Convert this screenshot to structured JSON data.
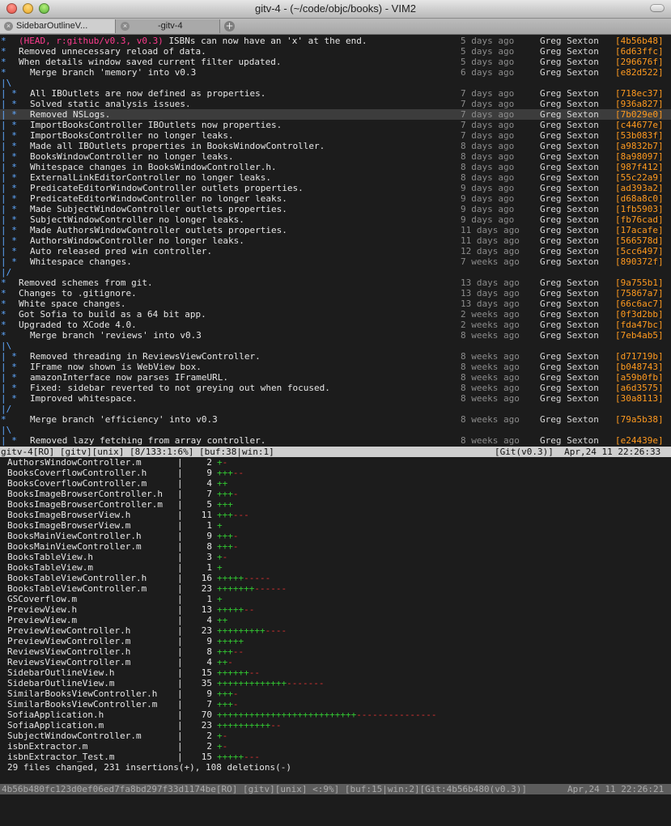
{
  "window": {
    "title": "gitv-4 - (~/code/objc/books) - VIM2"
  },
  "tabs": [
    {
      "label": "SidebarOutlineV...",
      "close": "×"
    },
    {
      "label": "-gitv-4",
      "close": "×"
    }
  ],
  "new_tab": "+",
  "log_lines": [
    {
      "graph": "*",
      "refs": "(HEAD, r:github/v0.3, v0.3)",
      "msg": "ISBNs can now have an 'x' at the end.",
      "date": "5 days ago",
      "author": "Greg Sexton",
      "sha": "[4b56b48]"
    },
    {
      "graph": "*",
      "msg": "Removed unnecessary reload of data.",
      "date": "5 days ago",
      "author": "Greg Sexton",
      "sha": "[6d63ffc]"
    },
    {
      "graph": "*",
      "msg": "When details window saved current filter updated.",
      "date": "5 days ago",
      "author": "Greg Sexton",
      "sha": "[296676f]"
    },
    {
      "graph": "*",
      "msg": "Merge branch 'memory' into v0.3",
      "date": "6 days ago",
      "author": "Greg Sexton",
      "sha": "[e82d522]",
      "merge": true
    },
    {
      "graph": "|\\"
    },
    {
      "graph": "| *",
      "msg": "All IBOutlets are now defined as properties.",
      "date": "7 days ago",
      "author": "Greg Sexton",
      "sha": "[718ec37]",
      "ind": true
    },
    {
      "graph": "| *",
      "msg": "Solved static analysis issues.",
      "date": "7 days ago",
      "author": "Greg Sexton",
      "sha": "[936a827]",
      "ind": true
    },
    {
      "graph": "| *",
      "msg": "Removed NSLogs.",
      "date": "7 days ago",
      "author": "Greg Sexton",
      "sha": "[7b029e0]",
      "ind": true,
      "cursor": true
    },
    {
      "graph": "| *",
      "msg": "ImportBooksController IBOutlets now properties.",
      "date": "7 days ago",
      "author": "Greg Sexton",
      "sha": "[c44677e]",
      "ind": true
    },
    {
      "graph": "| *",
      "msg": "ImportBooksController no longer leaks.",
      "date": "7 days ago",
      "author": "Greg Sexton",
      "sha": "[53b083f]",
      "ind": true
    },
    {
      "graph": "| *",
      "msg": "Made all IBOutlets properties in BooksWindowController.",
      "date": "8 days ago",
      "author": "Greg Sexton",
      "sha": "[a9832b7]",
      "ind": true
    },
    {
      "graph": "| *",
      "msg": "BooksWindowController no longer leaks.",
      "date": "8 days ago",
      "author": "Greg Sexton",
      "sha": "[8a98097]",
      "ind": true
    },
    {
      "graph": "| *",
      "msg": "Whitespace changes in BooksWindowController.h.",
      "date": "8 days ago",
      "author": "Greg Sexton",
      "sha": "[987f412]",
      "ind": true
    },
    {
      "graph": "| *",
      "msg": "ExternalLinkEditorController no longer leaks.",
      "date": "8 days ago",
      "author": "Greg Sexton",
      "sha": "[55c22a9]",
      "ind": true
    },
    {
      "graph": "| *",
      "msg": "PredicateEditorWindowController outlets properties.",
      "date": "9 days ago",
      "author": "Greg Sexton",
      "sha": "[ad393a2]",
      "ind": true
    },
    {
      "graph": "| *",
      "msg": "PredicateEditorWindowController no longer leaks.",
      "date": "9 days ago",
      "author": "Greg Sexton",
      "sha": "[d68a8c0]",
      "ind": true
    },
    {
      "graph": "| *",
      "msg": "Made SubjectWindowController outlets properties.",
      "date": "9 days ago",
      "author": "Greg Sexton",
      "sha": "[1fb5903]",
      "ind": true
    },
    {
      "graph": "| *",
      "msg": "SubjectWindowController no longer leaks.",
      "date": "9 days ago",
      "author": "Greg Sexton",
      "sha": "[fb76cad]",
      "ind": true
    },
    {
      "graph": "| *",
      "msg": "Made AuthorsWindowController outlets properties.",
      "date": "11 days ago",
      "author": "Greg Sexton",
      "sha": "[17acafe]",
      "ind": true
    },
    {
      "graph": "| *",
      "msg": "AuthorsWindowController no longer leaks.",
      "date": "11 days ago",
      "author": "Greg Sexton",
      "sha": "[566578d]",
      "ind": true
    },
    {
      "graph": "| *",
      "msg": "Auto released pred win controller.",
      "date": "12 days ago",
      "author": "Greg Sexton",
      "sha": "[5cc6497]",
      "ind": true
    },
    {
      "graph": "| *",
      "msg": "Whitespace changes.",
      "date": "7 weeks ago",
      "author": "Greg Sexton",
      "sha": "[890372f]",
      "ind": true
    },
    {
      "graph": "|/"
    },
    {
      "graph": "*",
      "msg": "Removed schemes from git.",
      "date": "13 days ago",
      "author": "Greg Sexton",
      "sha": "[9a755b1]"
    },
    {
      "graph": "*",
      "msg": "Changes to .gitignore.",
      "date": "13 days ago",
      "author": "Greg Sexton",
      "sha": "[75867a7]"
    },
    {
      "graph": "*",
      "msg": "White space changes.",
      "date": "13 days ago",
      "author": "Greg Sexton",
      "sha": "[66c6ac7]"
    },
    {
      "graph": "*",
      "msg": "Got Sofia to build as a 64 bit app.",
      "date": "2 weeks ago",
      "author": "Greg Sexton",
      "sha": "[0f3d2bb]"
    },
    {
      "graph": "*",
      "msg": "Upgraded to XCode 4.0.",
      "date": "2 weeks ago",
      "author": "Greg Sexton",
      "sha": "[fda47bc]"
    },
    {
      "graph": "*",
      "msg": "Merge branch 'reviews' into v0.3",
      "date": "8 weeks ago",
      "author": "Greg Sexton",
      "sha": "[7eb4ab5]",
      "merge": true
    },
    {
      "graph": "|\\"
    },
    {
      "graph": "| *",
      "msg": "Removed threading in ReviewsViewController.",
      "date": "8 weeks ago",
      "author": "Greg Sexton",
      "sha": "[d71719b]",
      "ind": true
    },
    {
      "graph": "| *",
      "msg": "IFrame now shown is WebView box.",
      "date": "8 weeks ago",
      "author": "Greg Sexton",
      "sha": "[b048743]",
      "ind": true
    },
    {
      "graph": "| *",
      "msg": "amazonInterface now parses IFrameURL.",
      "date": "8 weeks ago",
      "author": "Greg Sexton",
      "sha": "[a59b0fb]",
      "ind": true
    },
    {
      "graph": "| *",
      "msg": "Fixed: sidebar reverted to not greying out when focused.",
      "date": "8 weeks ago",
      "author": "Greg Sexton",
      "sha": "[a6d3575]",
      "ind": true
    },
    {
      "graph": "| *",
      "msg": "Improved whitespace.",
      "date": "8 weeks ago",
      "author": "Greg Sexton",
      "sha": "[30a8113]",
      "ind": true
    },
    {
      "graph": "|/"
    },
    {
      "graph": "*",
      "msg": "Merge branch 'efficiency' into v0.3",
      "date": "8 weeks ago",
      "author": "Greg Sexton",
      "sha": "[79a5b38]",
      "merge": true
    },
    {
      "graph": "|\\"
    },
    {
      "graph": "| *",
      "msg": "Removed lazy fetching from array controller.",
      "date": "8 weeks ago",
      "author": "Greg Sexton",
      "sha": "[e24439e]",
      "ind": true
    }
  ],
  "status_top": {
    "left": "gitv-4[RO] [gitv][unix] [8/133:1:6%] [buf:38|win:1]",
    "right": "[Git(v0.3)]  Apr,24 11 22:26:33"
  },
  "diff_lines": [
    {
      "file": "AuthorsWindowController.m",
      "count": "2",
      "plus": "+",
      "minus": "-"
    },
    {
      "file": "BooksCoverflowController.h",
      "count": "9",
      "plus": "+++",
      "minus": "--"
    },
    {
      "file": "BooksCoverflowController.m",
      "count": "4",
      "plus": "++",
      "minus": ""
    },
    {
      "file": "BooksImageBrowserController.h",
      "count": "7",
      "plus": "+++",
      "minus": "-"
    },
    {
      "file": "BooksImageBrowserController.m",
      "count": "5",
      "plus": "+++",
      "minus": ""
    },
    {
      "file": "BooksImageBrowserView.h",
      "count": "11",
      "plus": "+++",
      "minus": "---"
    },
    {
      "file": "BooksImageBrowserView.m",
      "count": "1",
      "plus": "+",
      "minus": ""
    },
    {
      "file": "BooksMainViewController.h",
      "count": "9",
      "plus": "+++",
      "minus": "-"
    },
    {
      "file": "BooksMainViewController.m",
      "count": "8",
      "plus": "+++",
      "minus": "-"
    },
    {
      "file": "BooksTableView.h",
      "count": "3",
      "plus": "+",
      "minus": "-"
    },
    {
      "file": "BooksTableView.m",
      "count": "1",
      "plus": "+",
      "minus": ""
    },
    {
      "file": "BooksTableViewController.h",
      "count": "16",
      "plus": "+++++",
      "minus": "-----"
    },
    {
      "file": "BooksTableViewController.m",
      "count": "23",
      "plus": "+++++++",
      "minus": "------"
    },
    {
      "file": "GSCoverflow.m",
      "count": "1",
      "plus": "+",
      "minus": ""
    },
    {
      "file": "PreviewView.h",
      "count": "13",
      "plus": "+++++",
      "minus": "--"
    },
    {
      "file": "PreviewView.m",
      "count": "4",
      "plus": "++",
      "minus": ""
    },
    {
      "file": "PreviewViewController.h",
      "count": "23",
      "plus": "+++++++++",
      "minus": "----"
    },
    {
      "file": "PreviewViewController.m",
      "count": "9",
      "plus": "+++++",
      "minus": ""
    },
    {
      "file": "ReviewsViewController.h",
      "count": "8",
      "plus": "+++",
      "minus": "--"
    },
    {
      "file": "ReviewsViewController.m",
      "count": "4",
      "plus": "++",
      "minus": "-"
    },
    {
      "file": "SidebarOutlineView.h",
      "count": "15",
      "plus": "++++++",
      "minus": "--"
    },
    {
      "file": "SidebarOutlineView.m",
      "count": "35",
      "plus": "+++++++++++++",
      "minus": "-------"
    },
    {
      "file": "SimilarBooksViewController.h",
      "count": "9",
      "plus": "+++",
      "minus": "-"
    },
    {
      "file": "SimilarBooksViewController.m",
      "count": "7",
      "plus": "+++",
      "minus": "-"
    },
    {
      "file": "SofiaApplication.h",
      "count": "70",
      "plus": "++++++++++++++++++++++++++",
      "minus": "---------------"
    },
    {
      "file": "SofiaApplication.m",
      "count": "23",
      "plus": "++++++++++",
      "minus": "--"
    },
    {
      "file": "SubjectWindowController.m",
      "count": "2",
      "plus": "+",
      "minus": "-"
    },
    {
      "file": "isbnExtractor.m",
      "count": "2",
      "plus": "+",
      "minus": "-"
    },
    {
      "file": "isbnExtractor_Test.m",
      "count": "15",
      "plus": "+++++",
      "minus": "---"
    }
  ],
  "diff_separator": "|",
  "summary": "29 files changed, 231 insertions(+), 108 deletions(-)",
  "status_bottom": {
    "left": "4b56b480fc123d0ef06ed7fa8bd297f33d1174be[RO] [gitv][unix] <:9%] [buf:15|win:2][Git:4b56b480(v0.3)]",
    "right": "Apr,24 11 22:26:21"
  },
  "colors": {
    "plus": "#32c832",
    "minus": "#e03232",
    "sha": "#ff9a1f",
    "refs": "#ff3b8e",
    "graph": "#5fa8ff"
  }
}
